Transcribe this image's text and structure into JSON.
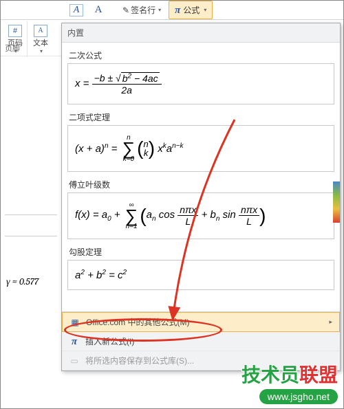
{
  "ribbon": {
    "page_number": "页码",
    "text_box": "文本",
    "header_footer": "页脚",
    "signature": "签名行",
    "equation": "公式"
  },
  "left": {
    "gamma_line": "γ ≈ 0.577"
  },
  "dropdown": {
    "builtin": "内置",
    "sections": {
      "quadratic": "二次公式",
      "binomial": "二项式定理",
      "fourier": "傅立叶级数",
      "pythag": "勾股定理"
    },
    "footer": {
      "office": "Office.com 中的其他公式(M)",
      "insert_new": "插入新公式(I)",
      "save_sel": "将所选内容保存到公式库(S)..."
    }
  },
  "watermark": {
    "line1a": "技术员",
    "line1b": "联盟",
    "url": "www.jsgho.net"
  },
  "icons": {
    "pi": "π",
    "hash": "#",
    "textA": "A",
    "dropcap": "A",
    "sig": "✎"
  }
}
